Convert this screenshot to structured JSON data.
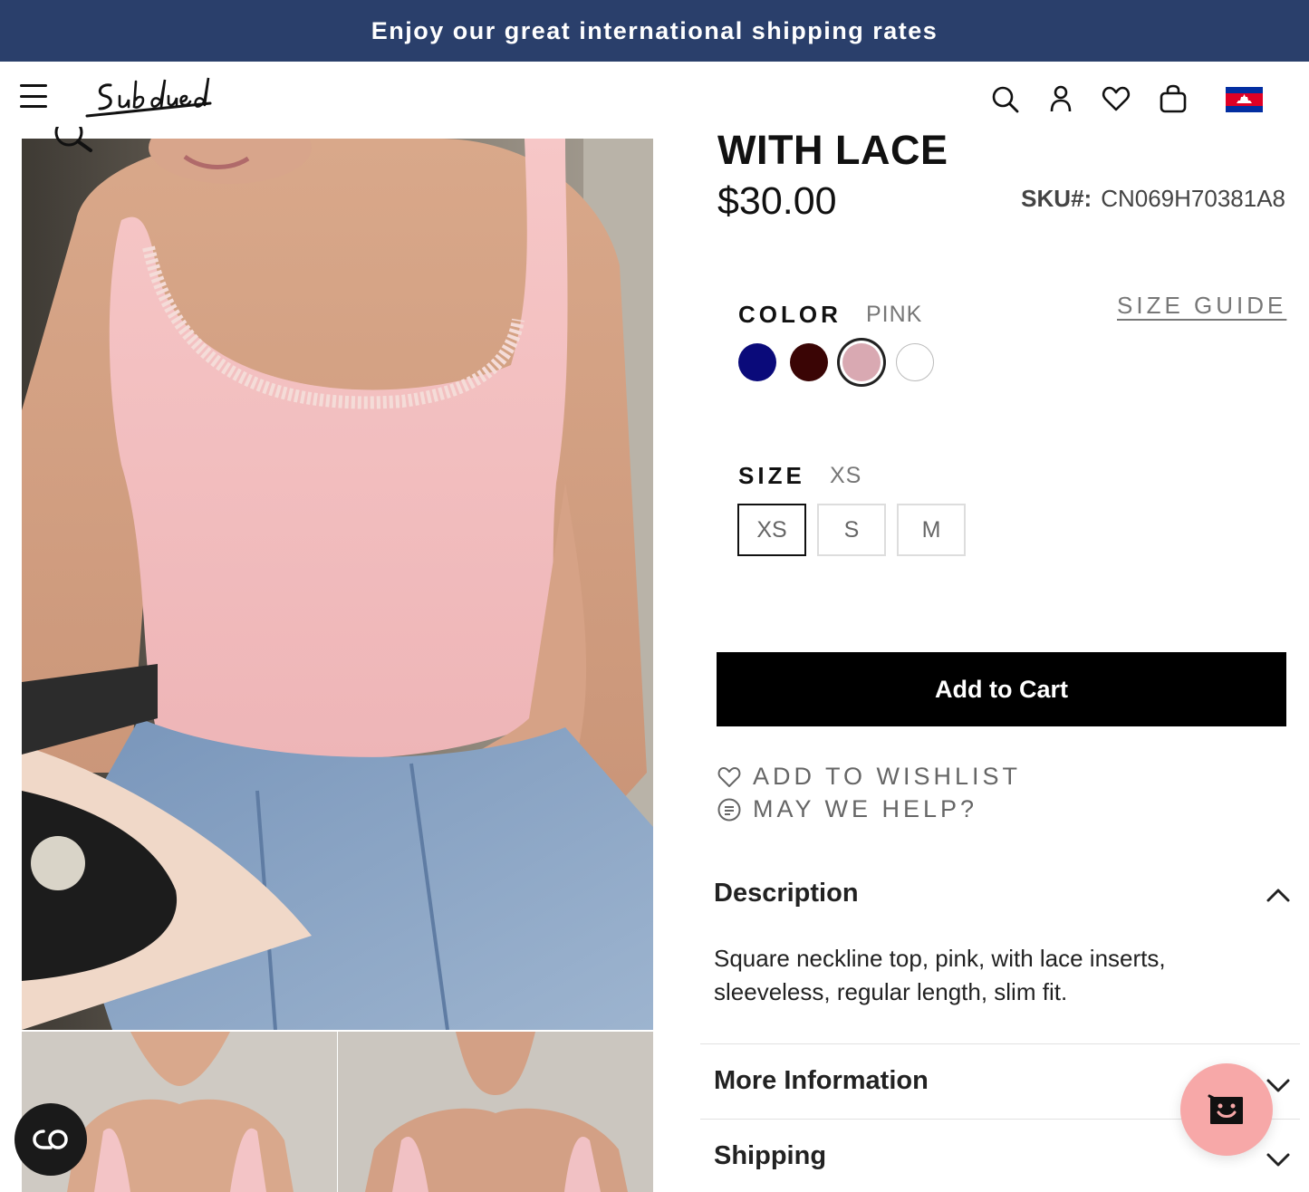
{
  "promo": {
    "text": "Enjoy our great international shipping rates"
  },
  "header": {
    "logo_text": "Subdued",
    "icons": [
      "menu-icon",
      "search-icon",
      "account-icon",
      "heart-icon",
      "bag-icon",
      "cambodia-flag-icon"
    ]
  },
  "product": {
    "title": "WITH LACE",
    "price": "$30.00",
    "sku_label": "SKU#:",
    "sku_value": "CN069H70381A8"
  },
  "color": {
    "label": "COLOR",
    "selected": "PINK",
    "swatches": [
      {
        "name": "navy",
        "hex": "#0a0a7a"
      },
      {
        "name": "burgundy",
        "hex": "#3a0505"
      },
      {
        "name": "pink",
        "hex": "#d9a9b2"
      },
      {
        "name": "white",
        "hex": "#ffffff"
      }
    ]
  },
  "size_guide": "SIZE GUIDE",
  "size": {
    "label": "SIZE",
    "selected": "XS",
    "options": [
      "XS",
      "S",
      "M"
    ]
  },
  "add_to_cart": "Add to Cart",
  "links": {
    "wishlist": "ADD TO WISHLIST",
    "help": "MAY WE HELP?"
  },
  "accordion": {
    "description_title": "Description",
    "description_text": "Square neckline top, pink, with lace inserts, sleeveless, regular length, slim fit.",
    "more_info_title": "More Information",
    "shipping_title": "Shipping"
  },
  "colors": {
    "promo_bg": "#2a3f6b",
    "chat_bg": "#f7a8a8",
    "button_bg": "#000000"
  }
}
